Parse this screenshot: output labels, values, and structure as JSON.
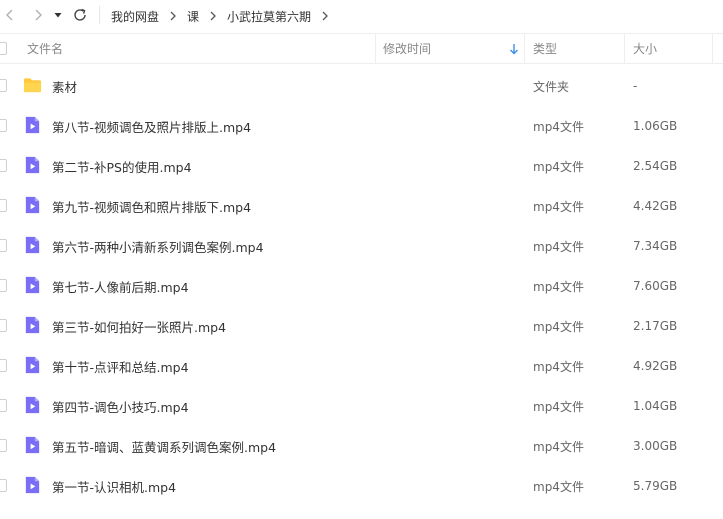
{
  "toolbar": {
    "back_icon": "chevron-left-icon",
    "forward_icon": "chevron-right-icon",
    "history_icon": "caret-down-icon",
    "refresh_icon": "refresh-icon"
  },
  "breadcrumb": [
    "我的网盘",
    "课",
    "小武拉莫第六期"
  ],
  "header": {
    "name": "文件名",
    "modified": "修改时间",
    "type": "类型",
    "size": "大小",
    "sort_icon": "sort-down-arrow-icon",
    "accent_color": "#3a8ee6"
  },
  "colors": {
    "folder": "#ffc83d",
    "video": "#7b6ef6"
  },
  "files": [
    {
      "name": "素材",
      "type": "文件夹",
      "size": "-",
      "icon": "folder-icon"
    },
    {
      "name": "第八节-视频调色及照片排版上.mp4",
      "type": "mp4文件",
      "size": "1.06GB",
      "icon": "video-file-icon"
    },
    {
      "name": "第二节-补PS的使用.mp4",
      "type": "mp4文件",
      "size": "2.54GB",
      "icon": "video-file-icon"
    },
    {
      "name": "第九节-视频调色和照片排版下.mp4",
      "type": "mp4文件",
      "size": "4.42GB",
      "icon": "video-file-icon"
    },
    {
      "name": "第六节-两种小清新系列调色案例.mp4",
      "type": "mp4文件",
      "size": "7.34GB",
      "icon": "video-file-icon"
    },
    {
      "name": "第七节-人像前后期.mp4",
      "type": "mp4文件",
      "size": "7.60GB",
      "icon": "video-file-icon"
    },
    {
      "name": "第三节-如何拍好一张照片.mp4",
      "type": "mp4文件",
      "size": "2.17GB",
      "icon": "video-file-icon"
    },
    {
      "name": "第十节-点评和总结.mp4",
      "type": "mp4文件",
      "size": "4.92GB",
      "icon": "video-file-icon"
    },
    {
      "name": "第四节-调色小技巧.mp4",
      "type": "mp4文件",
      "size": "1.04GB",
      "icon": "video-file-icon"
    },
    {
      "name": "第五节-暗调、蓝黄调系列调色案例.mp4",
      "type": "mp4文件",
      "size": "3.00GB",
      "icon": "video-file-icon"
    },
    {
      "name": "第一节-认识相机.mp4",
      "type": "mp4文件",
      "size": "5.79GB",
      "icon": "video-file-icon"
    }
  ]
}
